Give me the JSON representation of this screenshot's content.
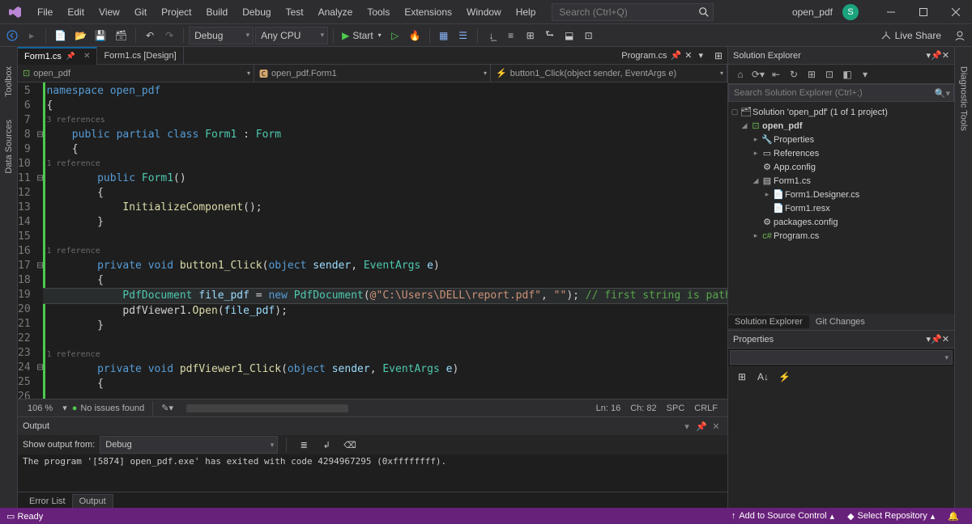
{
  "menubar": [
    "File",
    "Edit",
    "View",
    "Git",
    "Project",
    "Build",
    "Debug",
    "Test",
    "Analyze",
    "Tools",
    "Extensions",
    "Window",
    "Help"
  ],
  "search_placeholder": "Search (Ctrl+Q)",
  "project_name": "open_pdf",
  "user_initial": "S",
  "toolbar": {
    "config": "Debug",
    "platform": "Any CPU",
    "start_label": "Start",
    "liveshare": "Live Share"
  },
  "doc_tabs": {
    "active": "Form1.cs",
    "inactive": "Form1.cs [Design]",
    "right": "Program.cs"
  },
  "navbar": {
    "a": "open_pdf",
    "b": "open_pdf.Form1",
    "c": "button1_Click(object sender, EventArgs e)"
  },
  "code": {
    "line5": "namespace open_pdf",
    "l6": "{",
    "lens_class": "3 references",
    "l7a": "    public partial class ",
    "l7b": "Form1",
    "l7c": " : ",
    "l7d": "Form",
    "l8": "    {",
    "lens_ctor": "1 reference",
    "l9a": "        public ",
    "l9b": "Form1",
    "l9c": "()",
    "l10": "        {",
    "l11a": "            ",
    "l11b": "InitializeComponent",
    "l11c": "();",
    "l12": "        }",
    "lens_btn": "1 reference",
    "l14a": "        private void ",
    "l14b": "button1_Click",
    "l14c": "(",
    "l14d": "object ",
    "l14e": "sender",
    "l14f": ", ",
    "l14g": "EventArgs ",
    "l14h": "e",
    "l14i": ")",
    "l15": "        {",
    "l16a": "            ",
    "l16b": "PdfDocument ",
    "l16c": "file_pdf",
    "l16d": " = ",
    "l16e": "new ",
    "l16f": "PdfDocument",
    "l16g": "(",
    "l16h": "@\"C:\\Users\\DELL\\report.pdf\"",
    "l16i": ", ",
    "l16j": "\"\"",
    "l16k": "); ",
    "l16l": "// first string is path",
    "l17a": "            pdfViewer1.",
    "l17b": "Open",
    "l17c": "(",
    "l17d": "file_pdf",
    "l17e": ");",
    "l18": "        }",
    "lens_pv": "1 reference",
    "l20a": "        private void ",
    "l20b": "pdfViewer1_Click",
    "l20c": "(",
    "l20d": "object ",
    "l20e": "sender",
    "l20f": ", ",
    "l20g": "EventArgs ",
    "l20h": "e",
    "l20i": ")",
    "l21": "        {",
    "l23": "        }",
    "l24": "    }",
    "l25": "}"
  },
  "line_numbers": [
    "5",
    "6",
    "",
    "7",
    "8",
    "",
    "9",
    "10",
    "11",
    "12",
    "13",
    "",
    "14",
    "15",
    "16",
    "17",
    "18",
    "19",
    "",
    "20",
    "21",
    "22",
    "23",
    "24",
    "25",
    "26"
  ],
  "editor_status": {
    "zoom": "106 %",
    "issues": "No issues found",
    "ln": "Ln: 16",
    "ch": "Ch: 82",
    "spc": "SPC",
    "crlf": "CRLF"
  },
  "output": {
    "title": "Output",
    "from_label": "Show output from:",
    "from_value": "Debug",
    "text": "The program '[5874] open_pdf.exe' has exited with code 4294967295 (0xffffffff)."
  },
  "bottom_tabs": [
    "Error List",
    "Output"
  ],
  "solution_explorer": {
    "title": "Solution Explorer",
    "search_placeholder": "Search Solution Explorer (Ctrl+;)",
    "root": "Solution 'open_pdf' (1 of 1 project)",
    "proj": "open_pdf",
    "nodes": [
      "Properties",
      "References",
      "App.config",
      "Form1.cs",
      "Form1.Designer.cs",
      "Form1.resx",
      "packages.config",
      "Program.cs"
    ],
    "tabs": [
      "Solution Explorer",
      "Git Changes"
    ]
  },
  "properties": {
    "title": "Properties"
  },
  "left_tabs": [
    "Toolbox",
    "Data Sources"
  ],
  "right_tabs": [
    "Diagnostic Tools"
  ],
  "statusbar": {
    "ready": "Ready",
    "source_control": "Add to Source Control",
    "repo": "Select Repository"
  }
}
